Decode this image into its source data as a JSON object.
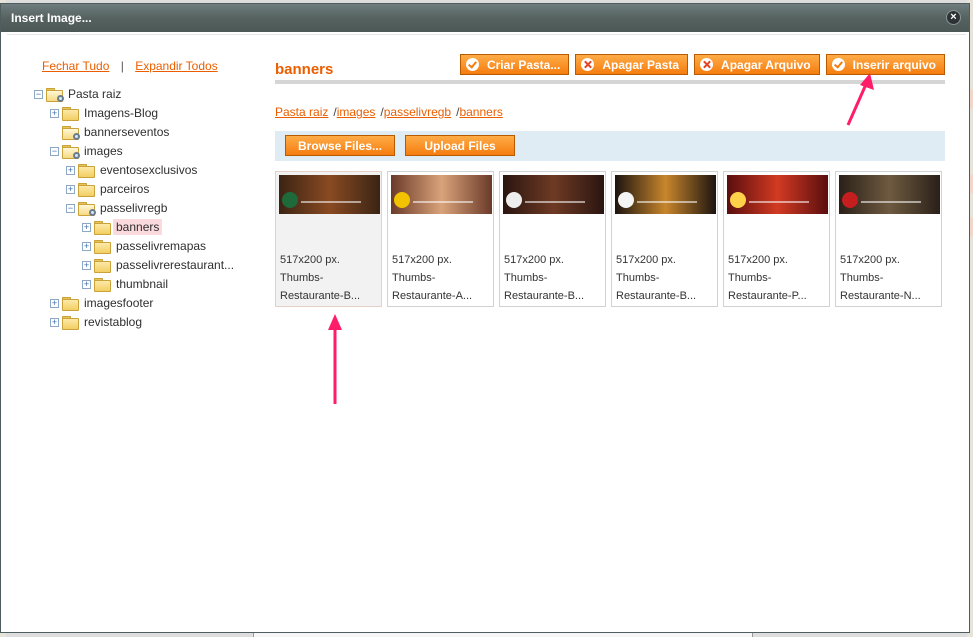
{
  "window": {
    "title": "Insert Image..."
  },
  "tree_actions": {
    "collapse_all": "Fechar Tudo",
    "separator": "|",
    "expand_all": "Expandir Todos"
  },
  "tree": [
    {
      "label": "Pasta raiz",
      "toggle": "−",
      "icon": "folder-search-icon",
      "depth": 0
    },
    {
      "label": "Imagens-Blog",
      "toggle": "+",
      "icon": "folder-icon",
      "depth": 1
    },
    {
      "label": "bannerseventos",
      "toggle": "",
      "icon": "folder-search-icon",
      "depth": 1
    },
    {
      "label": "images",
      "toggle": "−",
      "icon": "folder-search-icon",
      "depth": 1
    },
    {
      "label": "eventosexclusivos",
      "toggle": "+",
      "icon": "folder-icon",
      "depth": 2
    },
    {
      "label": "parceiros",
      "toggle": "+",
      "icon": "folder-icon",
      "depth": 2
    },
    {
      "label": "passelivregb",
      "toggle": "−",
      "icon": "folder-search-icon",
      "depth": 2
    },
    {
      "label": "banners",
      "toggle": "+",
      "icon": "folder-icon",
      "depth": 3,
      "selected": true
    },
    {
      "label": "passelivremapas",
      "toggle": "+",
      "icon": "folder-icon",
      "depth": 3
    },
    {
      "label": "passelivrerestaurant...",
      "toggle": "+",
      "icon": "folder-icon",
      "depth": 3
    },
    {
      "label": "thumbnail",
      "toggle": "+",
      "icon": "folder-icon",
      "depth": 3
    },
    {
      "label": "imagesfooter",
      "toggle": "+",
      "icon": "folder-icon",
      "depth": 1
    },
    {
      "label": "revistablog",
      "toggle": "+",
      "icon": "folder-icon",
      "depth": 1
    }
  ],
  "main": {
    "folder_title": "banners",
    "buttons": {
      "create_folder": "Criar Pasta...",
      "delete_folder": "Apagar Pasta",
      "delete_file": "Apagar Arquivo",
      "insert_file": "Inserir arquivo"
    },
    "breadcrumb": [
      "Pasta raiz",
      "images",
      "passelivregb",
      "banners"
    ],
    "upload": {
      "browse": "Browse Files...",
      "upload": "Upload Files"
    },
    "thumbnails": [
      {
        "dims": "517x200 px.",
        "name1": "Thumbs-",
        "name2": "Restaurante-B...",
        "selected": true,
        "colors": [
          "#3a2414",
          "#8a4a22"
        ],
        "logo": "#1e6a3a"
      },
      {
        "dims": "517x200 px.",
        "name1": "Thumbs-",
        "name2": "Restaurante-A...",
        "selected": false,
        "colors": [
          "#6b3b2a",
          "#d9a27a"
        ],
        "logo": "#f2c200"
      },
      {
        "dims": "517x200 px.",
        "name1": "Thumbs-",
        "name2": "Restaurante-B...",
        "selected": false,
        "colors": [
          "#2a1510",
          "#6e3a24"
        ],
        "logo": "#eeeeee"
      },
      {
        "dims": "517x200 px.",
        "name1": "Thumbs-",
        "name2": "Restaurante-B...",
        "selected": false,
        "colors": [
          "#1c1410",
          "#c8862c"
        ],
        "logo": "#f4f4f4"
      },
      {
        "dims": "517x200 px.",
        "name1": "Thumbs-",
        "name2": "Restaurante-P...",
        "selected": false,
        "colors": [
          "#5a0e0e",
          "#d23a22"
        ],
        "logo": "#ffd24a"
      },
      {
        "dims": "517x200 px.",
        "name1": "Thumbs-",
        "name2": "Restaurante-N...",
        "selected": false,
        "colors": [
          "#2a2018",
          "#6e5a40"
        ],
        "logo": "#c41e1e"
      }
    ]
  },
  "colors": {
    "accent": "#eb5e00",
    "button": "#f57c0f",
    "annotation": "#ff1d6a"
  }
}
